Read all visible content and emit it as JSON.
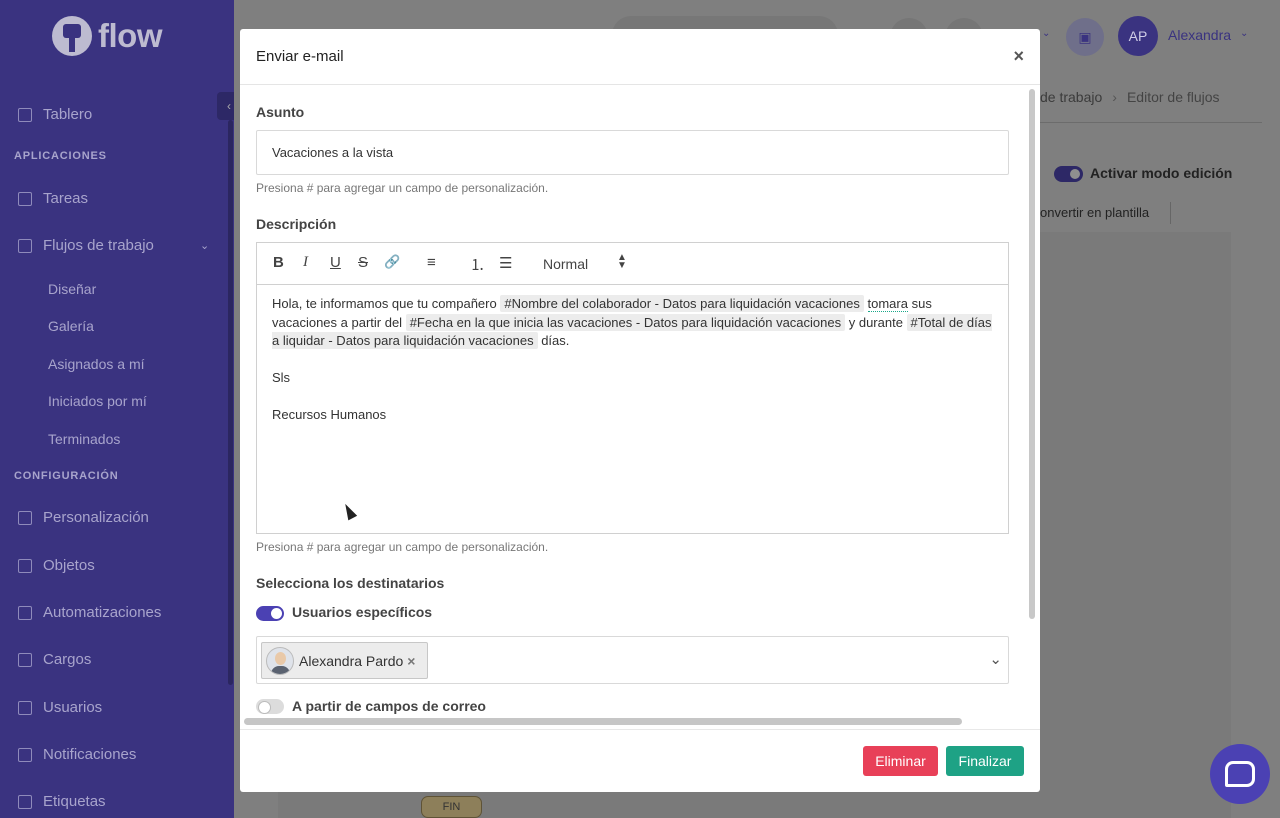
{
  "sidebar": {
    "logo_text": "flow",
    "items": [
      {
        "label": "Tablero",
        "icon": "home-icon"
      },
      {
        "label": "Tareas",
        "icon": "checkbox-icon"
      },
      {
        "label": "Flujos de trabajo",
        "icon": "workflow-icon"
      },
      {
        "label": "Personalización",
        "icon": "tag-icon"
      },
      {
        "label": "Objetos",
        "icon": "database-icon"
      },
      {
        "label": "Automatizaciones",
        "icon": "bell-icon"
      },
      {
        "label": "Cargos",
        "icon": "briefcase-icon"
      },
      {
        "label": "Usuarios",
        "icon": "user-icon"
      },
      {
        "label": "Notificaciones",
        "icon": "mail-icon"
      },
      {
        "label": "Etiquetas",
        "icon": "label-icon"
      }
    ],
    "sections": {
      "apps": "APLICACIONES",
      "config": "CONFIGURACIÓN"
    },
    "sub_items": [
      "Diseñar",
      "Galería",
      "Asignados a mí",
      "Iniciados por mí",
      "Terminados"
    ]
  },
  "header": {
    "avatar_initials": "AP",
    "user_name": "Alexandra",
    "breadcrumb": {
      "item": "de trabajo",
      "last": "Editor de flujos"
    }
  },
  "page": {
    "edit_mode_label": "Activar modo edición",
    "template_label": "onvertir en plantilla",
    "fin_node": "FIN"
  },
  "modal": {
    "title": "Enviar e-mail",
    "close": "×",
    "subject_label": "Asunto",
    "subject_value": "Vacaciones a la vista",
    "subject_help": "Presiona # para agregar un campo de personalización.",
    "description_label": "Descripción",
    "toolbar": {
      "bold": "B",
      "italic": "I",
      "underline": "U",
      "strike": "S",
      "link": "🔗",
      "align": "≡",
      "ordered_list": "⒈",
      "bullet_list": "☰",
      "format": "Normal"
    },
    "body": {
      "p1_a": "Hola, te informamos que tu compañero ",
      "tag1": "#Nombre del colaborador - Datos para liquidación vacaciones",
      "p1_b": " ",
      "word_tomara": "tomara",
      "p1_c": " sus vacaciones a partir del ",
      "tag2": "#Fecha en la que inicia las vacaciones - Datos para liquidación vacaciones",
      "p1_d": " y durante ",
      "tag3": "#Total de días a liquidar - Datos para liquidación vacaciones",
      "p1_e": " días.",
      "p2": "Sls",
      "p3": "Recursos Humanos"
    },
    "description_help": "Presiona # para agregar un campo de personalización.",
    "recipients_label": "Selecciona los destinatarios",
    "specific_users_label": "Usuarios específicos",
    "selected_user": "Alexandra Pardo",
    "email_fields_label": "A partir de campos de correo",
    "delete_button": "Eliminar",
    "finish_button": "Finalizar"
  }
}
